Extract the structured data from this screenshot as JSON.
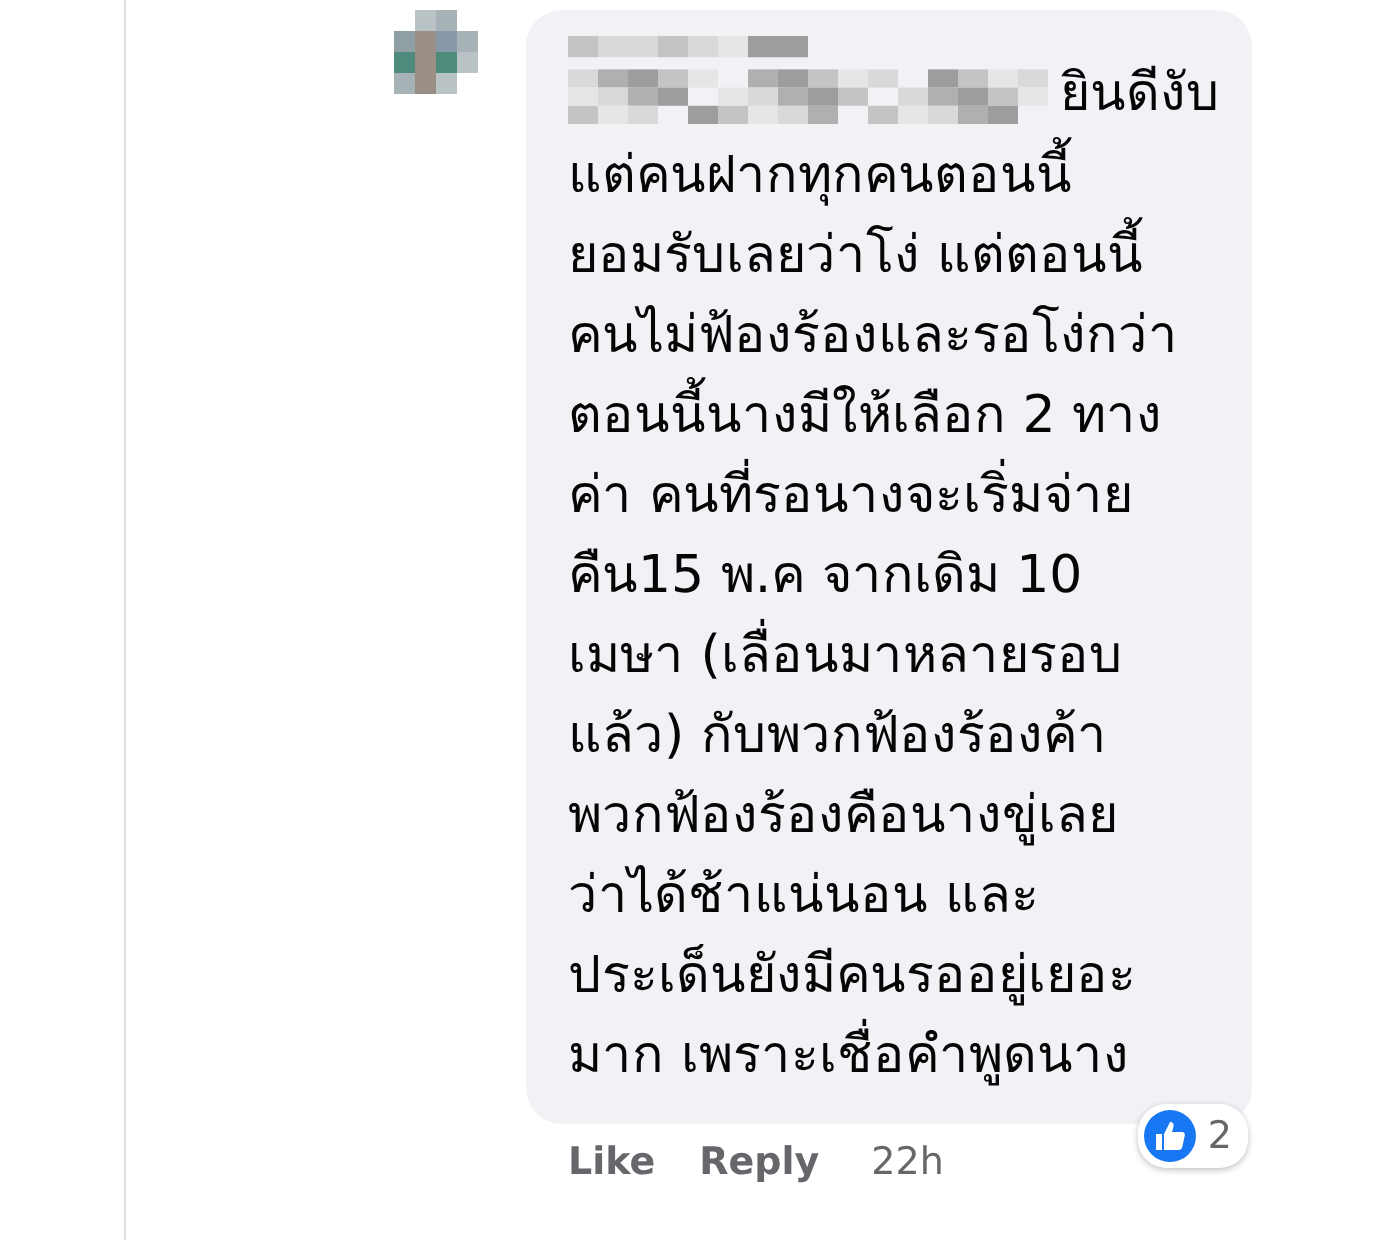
{
  "comment": {
    "text_parts": [
      "ยินดีงับ",
      "แต่คนฝากทุกคนตอนนี้\nยอมรับเลยว่าโง่ แต่ตอนนี้\nคนไม่ฟ้องร้องและรอโง่กว่า\nตอนนี้นางมีให้เลือก 2 ทาง\nค่า คนที่รอนางจะเริ่มจ่าย\nคืน15 พ.ค จากเดิม 10\nเมษา (เลื่อนมาหลายรอบ\nแล้ว) กับพวกฟ้องร้องค้า\nพวกฟ้องร้องคือนางขู่เลย\nว่าได้ช้าแน่นอน และ\nประเด็นยังมีคนรออยู่เยอะ\nมาก เพราะเชื่อคำพูดนาง"
    ],
    "reactions": {
      "count": "2"
    },
    "actions": [
      {
        "label": "Like"
      },
      {
        "label": "Reply"
      }
    ],
    "time": "22h"
  }
}
